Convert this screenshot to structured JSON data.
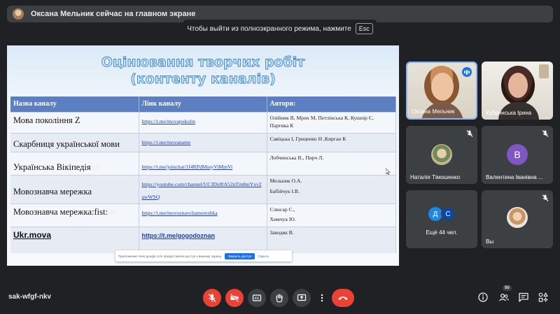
{
  "presenter_bar": {
    "text": "Оксана Мельник сейчас на главном экране"
  },
  "fullscreen_hint": {
    "text": "Чтобы выйти из полноэкранного режима, нажмите",
    "key": "Esc"
  },
  "slide": {
    "title_line1": "Оцінювання творчих робіт",
    "title_line2": "(контенту каналів)",
    "columns": [
      "Назва каналу",
      "Лінк каналу",
      "Автори:"
    ],
    "rows": [
      {
        "name": "Мова покоління Z",
        "link": "https://t.me/movapokolin",
        "authors": "Олійник В, Мриx М, Петлінська К, Кушнір Є, Партика К"
      },
      {
        "name": "Скарбниця української мови",
        "link": "https://t.me/movaname",
        "authors": "Савіцька І, Гриценко Н ,Кирган К"
      },
      {
        "name": "Українська Вікіпедія",
        "name_tag": "UA",
        "link": "https://t.me/joinchat/1f4RPdMssyViMmVi",
        "authors": "Лобчинська В., Пирч Л."
      },
      {
        "name": "Мовознавча мережка",
        "link": "https://youtube.com/channel/UCJDirRA52nTm8mYxv2awWSQ",
        "authors": "Мельник О.А.",
        "authors2": "Бабійчук І.В."
      },
      {
        "name": "Мовознавча мережка:fist:",
        "name_tag": "UA",
        "link": "https://t.me/movoznavchamerezhka",
        "authors": "Слюсар С.,",
        "authors2": "Химчук Ю."
      },
      {
        "name": "Ukr.mova",
        "link": "https://t.me/gogodoznan",
        "authors": "Заводяк В."
      }
    ],
    "popup": {
      "text": "Приложение meet.google.com предоставлен доступ к вашему экрану.",
      "allow": "Закрыть доступ",
      "hide": "Скрыть"
    }
  },
  "participants": [
    {
      "name": "Оксана Мельник",
      "state": "speaking"
    },
    {
      "name": "Кубринська Ірина",
      "state": "video"
    },
    {
      "name": "Наталія Тімошенко",
      "state": "muted"
    },
    {
      "name": "Валентина Іванівна ...",
      "initial": "В",
      "avatar_color": "#7e57c2",
      "state": "muted"
    },
    {
      "name": "Ещё 44 чел.",
      "initials": [
        "Д",
        "С"
      ],
      "colors": [
        "#1e88e5",
        "#0d47a1"
      ]
    },
    {
      "name": "Вы",
      "state": "muted"
    }
  ],
  "bottom_bar": {
    "meeting_code": "sak-wfgf-nkv",
    "people_count": "50"
  },
  "colors": {
    "danger": "#ea4335",
    "control_bg": "#3c4043",
    "accent": "#1a73e8"
  }
}
